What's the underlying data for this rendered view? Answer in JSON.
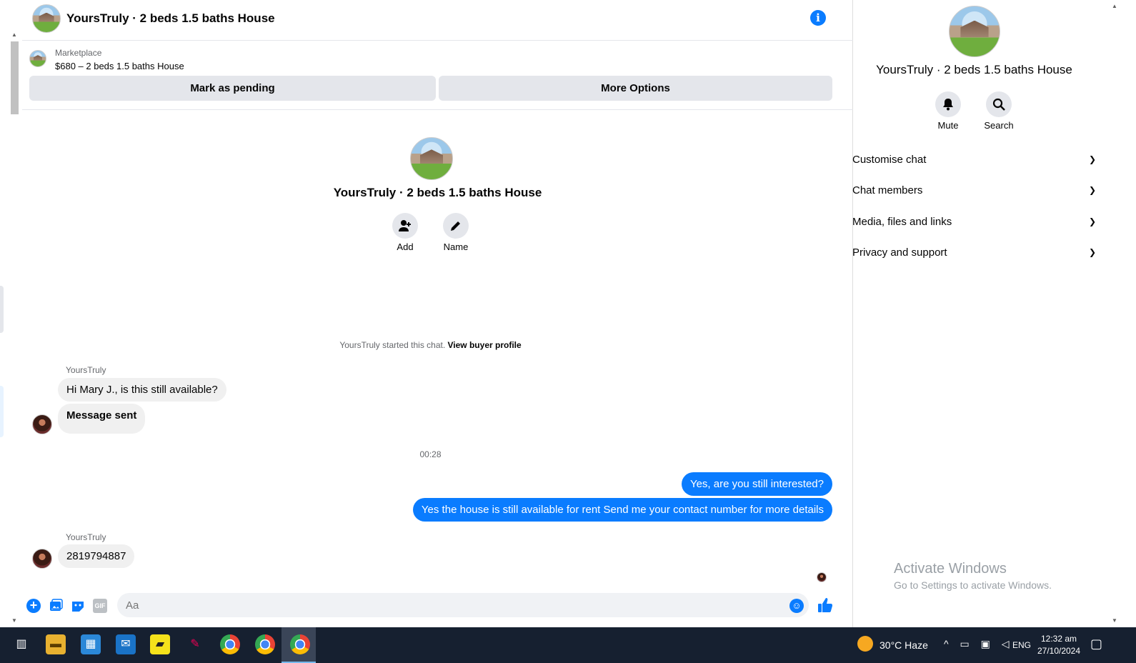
{
  "header": {
    "title": "YoursTruly · 2 beds 1.5 baths House"
  },
  "listing": {
    "kicker": "Marketplace",
    "price_title": "$680 – 2 beds 1.5 baths House",
    "mark_pending_label": "Mark as pending",
    "more_options_label": "More Options"
  },
  "intro": {
    "title": "YoursTruly · 2 beds 1.5 baths House",
    "add_label": "Add",
    "name_label": "Name"
  },
  "conversation": {
    "started_text": "YoursTruly started this chat.",
    "view_profile_link": "View buyer profile",
    "timestamp": "00:28",
    "messages": [
      {
        "sender": "YoursTruly",
        "text": "Hi Mary J., is this still available?",
        "direction": "in"
      },
      {
        "text": "Message sent",
        "direction": "in"
      },
      {
        "text": "Yes, are you still interested?",
        "direction": "out"
      },
      {
        "text": "Yes the house is still available for rent Send me your contact number for more details",
        "direction": "out"
      },
      {
        "sender": "YoursTruly",
        "text": "2819794887",
        "direction": "in"
      }
    ]
  },
  "composer": {
    "placeholder": "Aa",
    "gif_label": "GIF"
  },
  "sidebar": {
    "title": "YoursTruly · 2 beds 1.5 baths House",
    "mute_label": "Mute",
    "search_label": "Search",
    "sections": [
      {
        "label": "Customise chat"
      },
      {
        "label": "Chat members"
      },
      {
        "label": "Media, files and links"
      },
      {
        "label": "Privacy and support"
      }
    ]
  },
  "watermark": {
    "line1": "Activate Windows",
    "line2": "Go to Settings to activate Windows."
  },
  "taskbar": {
    "weather": "30°C  Haze",
    "language": "ENG",
    "time": "12:32 am",
    "date": "27/10/2024"
  },
  "colors": {
    "accent": "#0a7cff",
    "bubble_in": "#f0f0f0",
    "taskbar": "#162030"
  }
}
